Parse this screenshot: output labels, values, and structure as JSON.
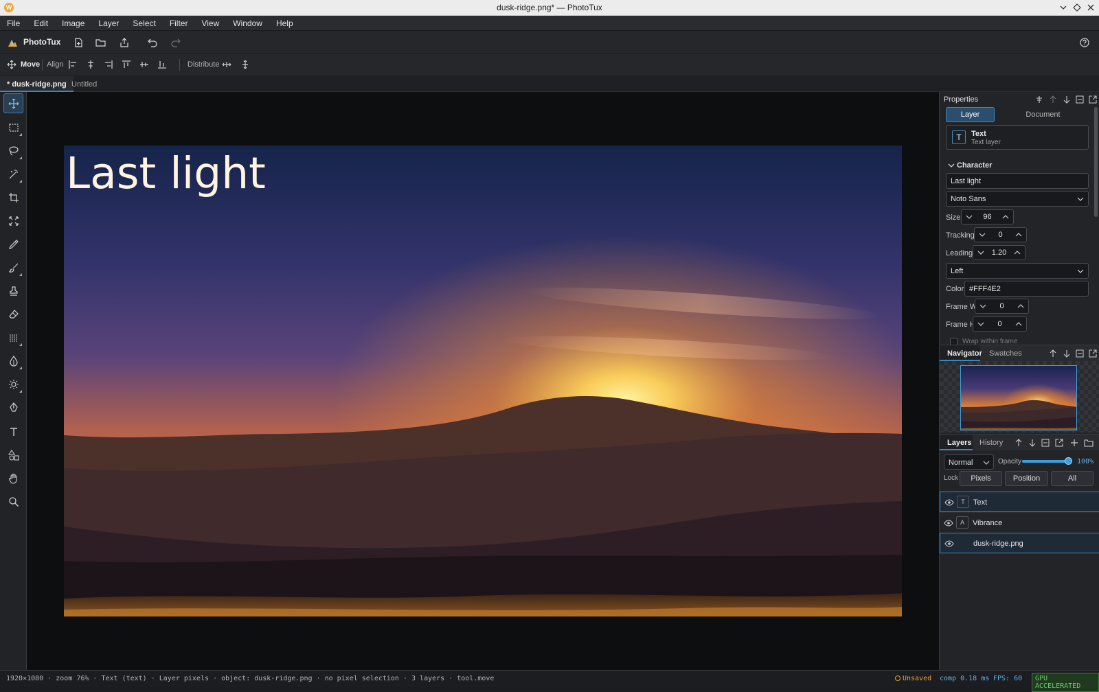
{
  "window": {
    "title": "dusk-ridge.png* — PhotoTux",
    "logo_letter": "W"
  },
  "menu": [
    "File",
    "Edit",
    "Image",
    "Layer",
    "Select",
    "Filter",
    "View",
    "Window",
    "Help"
  ],
  "app": {
    "name": "PhotoTux"
  },
  "options": {
    "tool": "Move",
    "align_label": "Align",
    "distribute_label": "Distribute"
  },
  "tabs": [
    {
      "label": "* dusk-ridge.png",
      "active": true
    },
    {
      "label": "Untitled",
      "active": false
    }
  ],
  "canvas": {
    "text": "Last light",
    "text_color": "#FFF4E2"
  },
  "properties": {
    "title": "Properties",
    "tabs": [
      "Layer",
      "Document"
    ],
    "layer_name": "Text",
    "layer_type": "Text layer",
    "layer_icon": "T",
    "section": "Character",
    "text_value": "Last light",
    "font": "Noto Sans",
    "size_label": "Size",
    "size": "96",
    "tracking_label": "Tracking",
    "tracking": "0",
    "leading_label": "Leading",
    "leading": "1.20",
    "align": "Left",
    "color_label": "Color",
    "color": "#FFF4E2",
    "frame_w_label": "Frame W",
    "frame_w": "0",
    "frame_h_label": "Frame H",
    "frame_h": "0",
    "wrap_label": "Wrap within frame"
  },
  "navigator": {
    "tabs": [
      "Navigator",
      "Swatches"
    ]
  },
  "layers_panel": {
    "tabs": [
      "Layers",
      "History"
    ],
    "blend": "Normal",
    "opacity_label": "Opacity",
    "opacity": "100%",
    "opacity_fraction": 1.0,
    "lock_label": "Lock",
    "lock_buttons": [
      "Pixels",
      "Position",
      "All"
    ],
    "layers": [
      {
        "name": "Text",
        "icon": "T",
        "selected": true
      },
      {
        "name": "Vibrance",
        "icon": "A",
        "selected": false
      },
      {
        "name": "dusk-ridge.png",
        "icon": "",
        "selected": true
      }
    ]
  },
  "status": {
    "left": "1920×1080 · zoom 76% · Text (text) · Layer pixels · object: dusk-ridge.png · no pixel selection · 3 layers · tool.move",
    "unsaved": "Unsaved",
    "comp": "comp 0.18 ms",
    "fps": "FPS: 60",
    "gpu": "GPU ACCELERATED"
  },
  "colors": {
    "accent": "#3b88c0",
    "warning": "#e8a33a",
    "gpu_green": "#6cc86c"
  }
}
